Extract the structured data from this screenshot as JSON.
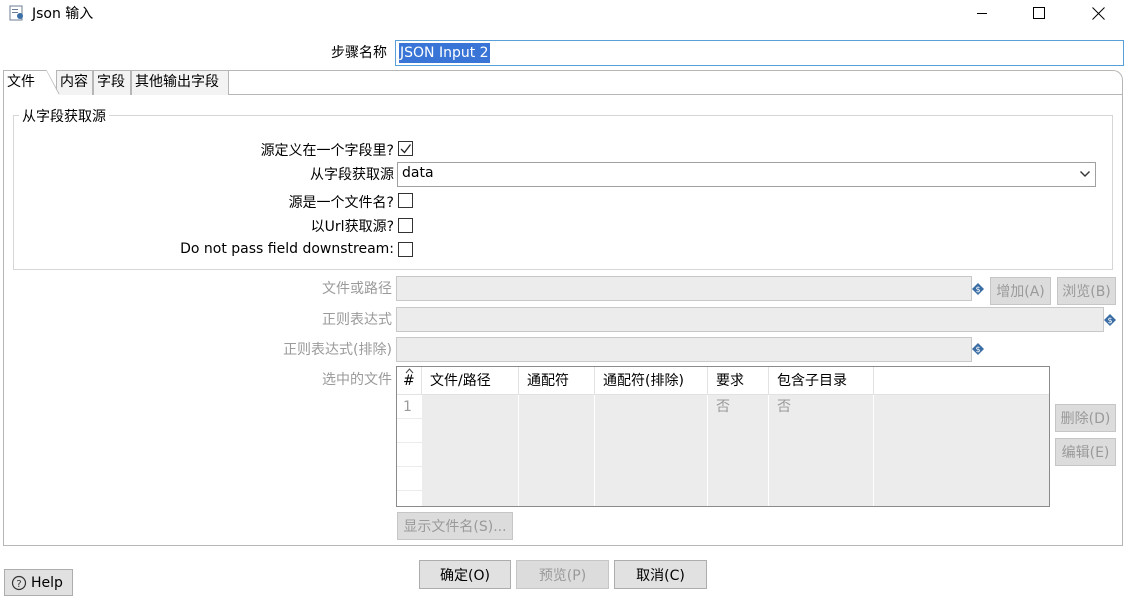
{
  "window": {
    "title": "Json 输入",
    "minimize_glyph": "minimize",
    "maximize_glyph": "maximize",
    "close_glyph": "close"
  },
  "step": {
    "label": "步骤名称",
    "value": "JSON Input 2"
  },
  "tabs": [
    {
      "label": "文件",
      "active": true
    },
    {
      "label": "内容",
      "active": false
    },
    {
      "label": "字段",
      "active": false
    },
    {
      "label": "其他输出字段",
      "active": false
    }
  ],
  "source_group": {
    "title": "从字段获取源",
    "source_in_field_label": "源定义在一个字段里?",
    "source_in_field_checked": true,
    "source_field_label": "从字段获取源",
    "source_field_value": "data",
    "is_filename_label": "源是一个文件名?",
    "is_filename_checked": false,
    "read_url_label": "以Url获取源?",
    "read_url_checked": false,
    "do_not_pass_label": "Do not pass field downstream:",
    "do_not_pass_checked": false
  },
  "file": {
    "file_or_path_label": "文件或路径",
    "add_button": "增加(A)",
    "browse_button": "浏览(B)",
    "regex_label": "正则表达式",
    "regex_exclude_label": "正则表达式(排除)",
    "selected_files_label": "选中的文件",
    "delete_button": "删除(D)",
    "edit_button": "编辑(E)",
    "show_filenames_button": "显示文件名(S)..."
  },
  "files_table": {
    "sort_indicator": "^",
    "columns": [
      "#",
      "文件/路径",
      "通配符",
      "通配符(排除)",
      "要求",
      "包含子目录"
    ],
    "rows": [
      {
        "num": "1",
        "path": "",
        "wildcard": "",
        "wildcard_exclude": "",
        "required": "否",
        "include_subfolders": "否"
      }
    ]
  },
  "footer": {
    "help_button": "Help",
    "ok_button": "确定(O)",
    "preview_button": "预览(P)",
    "cancel_button": "取消(C)"
  },
  "colors": {
    "selection": "#3875d7",
    "focus_border": "#5aa0d8",
    "variable_diamond": "#3a6ea5"
  }
}
